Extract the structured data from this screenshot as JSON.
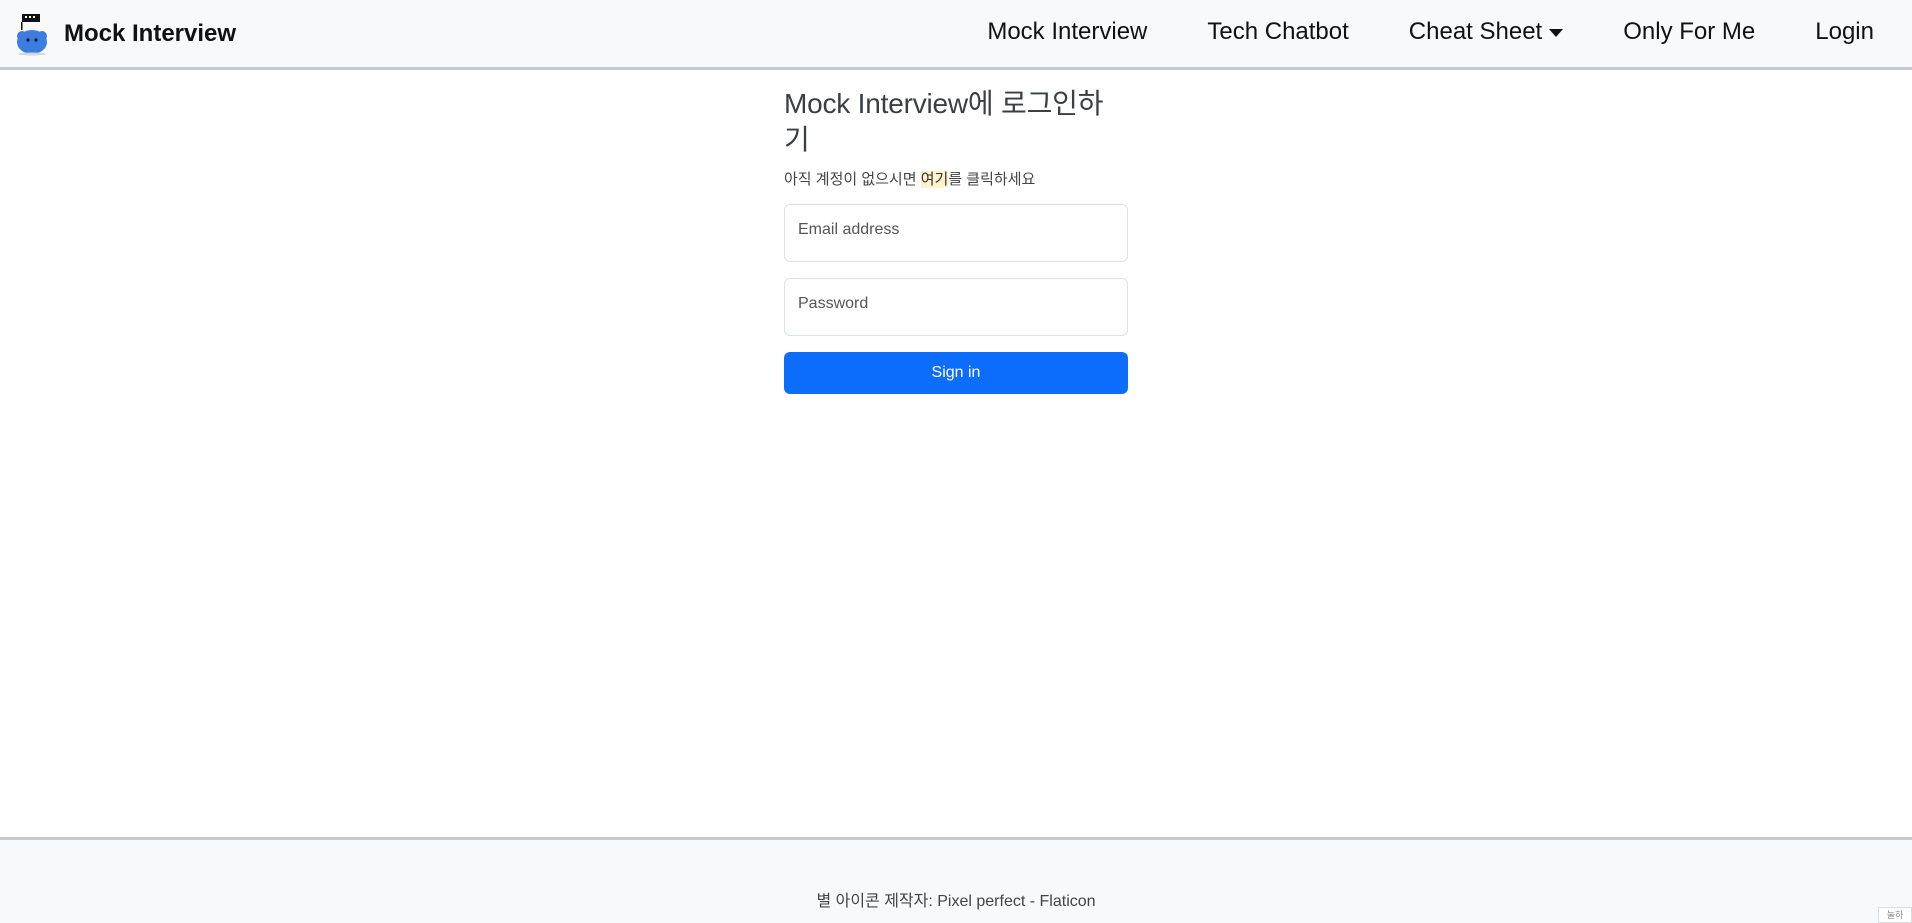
{
  "navbar": {
    "brand": "Mock Interview",
    "logo_icon": "mascot-logo-icon",
    "links": [
      {
        "label": "Mock Interview"
      },
      {
        "label": "Tech Chatbot"
      },
      {
        "label": "Cheat Sheet",
        "has_dropdown": true
      },
      {
        "label": "Only For Me"
      },
      {
        "label": "Login"
      }
    ]
  },
  "login": {
    "title": "Mock Interview에 로그인하기",
    "hint_prefix": "아직 계정이 없으시면 ",
    "hint_link": "여기",
    "hint_suffix": "를 클릭하세요",
    "email_label": "Email address",
    "password_label": "Password",
    "signin_label": "Sign in"
  },
  "footer": {
    "credit": "별 아이콘 제작자: Pixel perfect - Flaticon"
  },
  "corner_badge": "눌하",
  "colors": {
    "primary": "#0d6efd",
    "navbar_bg": "#f8f9fa",
    "link_highlight": "#fff3cd"
  }
}
